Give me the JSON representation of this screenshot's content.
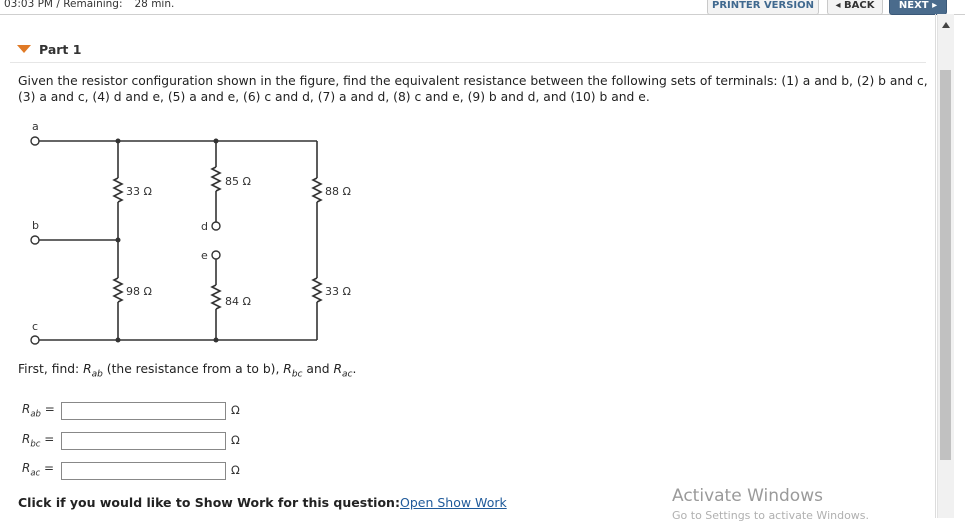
{
  "header": {
    "time": "03:03 PM / Remaining:",
    "remaining": "28 min.",
    "printer_label": "PRINTER VERSION",
    "back_label": "◂ BACK",
    "next_label": "NEXT ▸"
  },
  "part": {
    "title": "Part 1"
  },
  "question": "Given the resistor configuration shown in the figure, find the equivalent resistance between the following sets of terminals: (1) a and b, (2) b and c, (3) a and c, (4) d and e, (5) a and e, (6) c and d, (7) a and d, (8) c and e, (9) b and d, and (10) b and e.",
  "circuit": {
    "terminals": {
      "a": "a",
      "b": "b",
      "c": "c",
      "d": "d",
      "e": "e"
    },
    "resistors": {
      "r33_left": "33 Ω",
      "r85": "85 Ω",
      "r88": "88 Ω",
      "r98": "98 Ω",
      "r84": "84 Ω",
      "r33_right": "33 Ω"
    }
  },
  "prompt": {
    "prefix": "First, find: ",
    "rab_sym": "R",
    "rab_sub": "ab",
    "rab_desc": " (the resistance from a to b), ",
    "rbc_sym": "R",
    "rbc_sub": "bc",
    "and_text": " and ",
    "rac_sym": "R",
    "rac_sub": "ac",
    "end": "."
  },
  "answers": [
    {
      "sym": "R",
      "sub": "ab",
      "eq": " =",
      "value": "",
      "unit": "Ω"
    },
    {
      "sym": "R",
      "sub": "bc",
      "eq": " =",
      "value": "",
      "unit": "Ω"
    },
    {
      "sym": "R",
      "sub": "ac",
      "eq": " =",
      "value": "",
      "unit": "Ω"
    }
  ],
  "showwork": {
    "label": "Click if you would like to Show Work for this question:",
    "link": "Open Show Work"
  },
  "watermark": {
    "title": "Activate Windows",
    "subtitle": "Go to Settings to activate Windows."
  }
}
